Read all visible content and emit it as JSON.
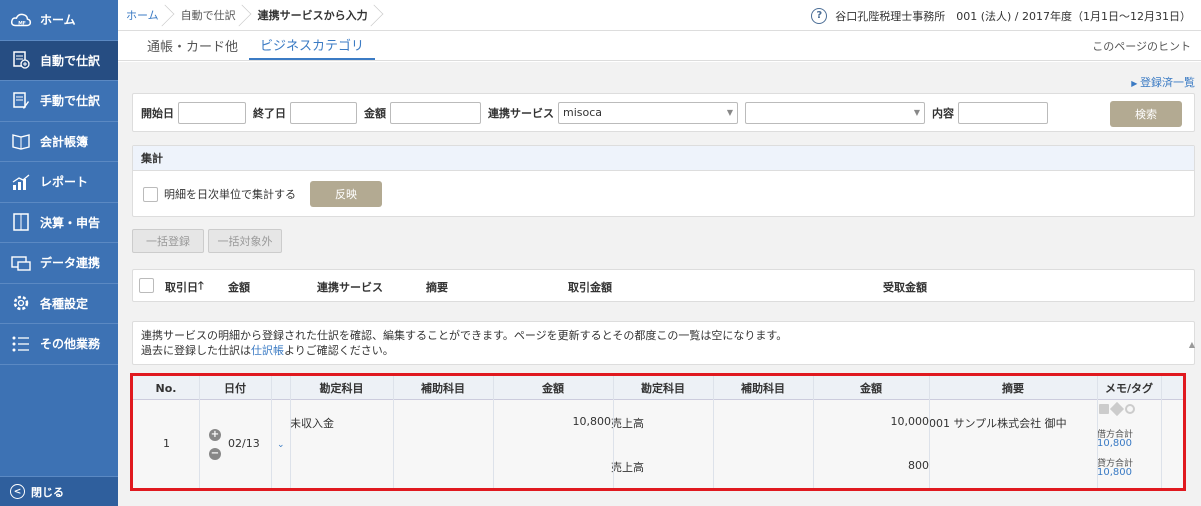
{
  "sidebar": {
    "items": [
      {
        "label": "ホーム",
        "icon": "cloud-mf-icon"
      },
      {
        "label": "自動で仕訳",
        "icon": "auto-journal-icon"
      },
      {
        "label": "手動で仕訳",
        "icon": "manual-journal-icon"
      },
      {
        "label": "会計帳簿",
        "icon": "book-icon"
      },
      {
        "label": "レポート",
        "icon": "report-chart-icon"
      },
      {
        "label": "決算・申告",
        "icon": "settlement-icon"
      },
      {
        "label": "データ連携",
        "icon": "data-link-icon"
      },
      {
        "label": "各種設定",
        "icon": "gear-icon"
      },
      {
        "label": "その他業務",
        "icon": "list-icon"
      }
    ],
    "close_label": "閉じる"
  },
  "breadcrumb": {
    "items": [
      "ホーム",
      "自動で仕訳",
      "連携サービスから入力"
    ]
  },
  "header": {
    "office": "谷口孔陛税理士事務所　001 (法人) / 2017年度（1月1日〜12月31日）"
  },
  "tabs": {
    "items": [
      "通帳・カード他",
      "ビジネスカテゴリ"
    ],
    "hint": "このページのヒント"
  },
  "registered_link": "登録済一覧",
  "filter": {
    "start_label": "開始日",
    "end_label": "終了日",
    "amount_label": "金額",
    "service_label": "連携サービス",
    "service_value": "misoca",
    "content_label": "内容",
    "search_label": "検索"
  },
  "aggregate": {
    "title": "集計",
    "checkbox_label": "明細を日次単位で集計する",
    "reflect_label": "反映"
  },
  "bulk": {
    "register_label": "一括登録",
    "exclude_label": "一括対象外"
  },
  "list_headers": [
    "取引日",
    "金額",
    "連携サービス",
    "摘要",
    "取引金額",
    "受取金額"
  ],
  "info": {
    "line1": "連携サービスの明細から登録された仕訳を確認、編集することができます。ページを更新するとその都度この一覧は空になります。",
    "line2_prefix": "過去に登録した仕訳は",
    "line2_link": "仕訳帳",
    "line2_suffix": "よりご確認ください。"
  },
  "journal": {
    "headers": [
      "No.",
      "日付",
      "勘定科目",
      "補助科目",
      "金額",
      "勘定科目",
      "補助科目",
      "金額",
      "摘要",
      "メモ/タグ"
    ],
    "row": {
      "no": "1",
      "date": "02/13",
      "debit_account": "未収入金",
      "debit_amount": "10,800",
      "credit_account_1": "売上高",
      "credit_amount_1": "10,000",
      "description": "001 サンプル株式会社 御中",
      "credit_account_2": "売上高",
      "credit_amount_2": "800",
      "debit_total_label": "借方合計",
      "debit_total": "10,800",
      "credit_total_label": "貸方合計",
      "credit_total": "10,800"
    }
  }
}
